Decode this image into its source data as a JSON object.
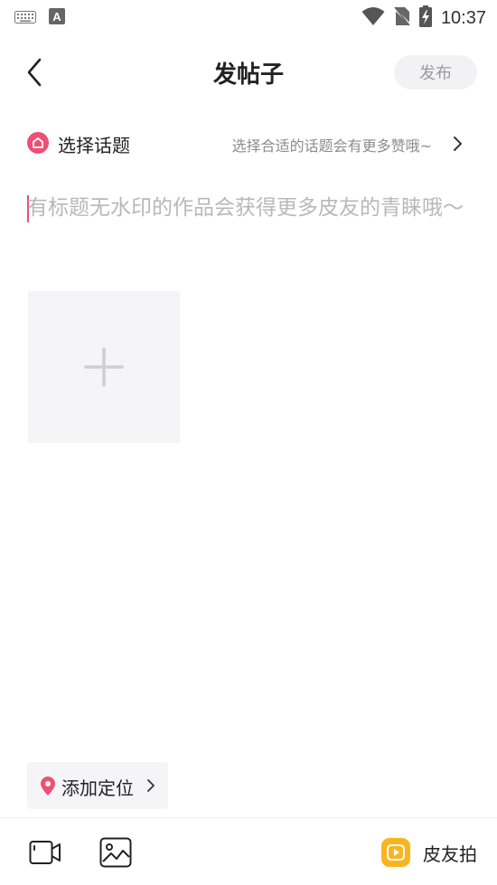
{
  "status_bar": {
    "time": "10:37",
    "icons": [
      "keyboard-icon",
      "a-icon",
      "wifi-icon",
      "no-sim-icon",
      "battery-charging-icon"
    ]
  },
  "header": {
    "title": "发帖子",
    "publish_label": "发布",
    "back_icon": "back-arrow-icon"
  },
  "topic": {
    "label": "选择话题",
    "hint": "选择合适的话题会有更多赞哦~",
    "icon": "topic-icon"
  },
  "editor": {
    "placeholder": "有标题无水印的作品会获得更多皮友的青睐哦～"
  },
  "media": {
    "add_icon": "plus-icon"
  },
  "location": {
    "label": "添加定位",
    "icon": "location-pin-icon"
  },
  "bottom_bar": {
    "video_icon": "video-icon",
    "image_icon": "image-icon",
    "pipai_label": "皮友拍",
    "pipai_icon": "pipai-play-icon"
  },
  "colors": {
    "accent": "#ee4f74",
    "orange": "#f9b520",
    "placeholder": "#b8b8b8"
  }
}
